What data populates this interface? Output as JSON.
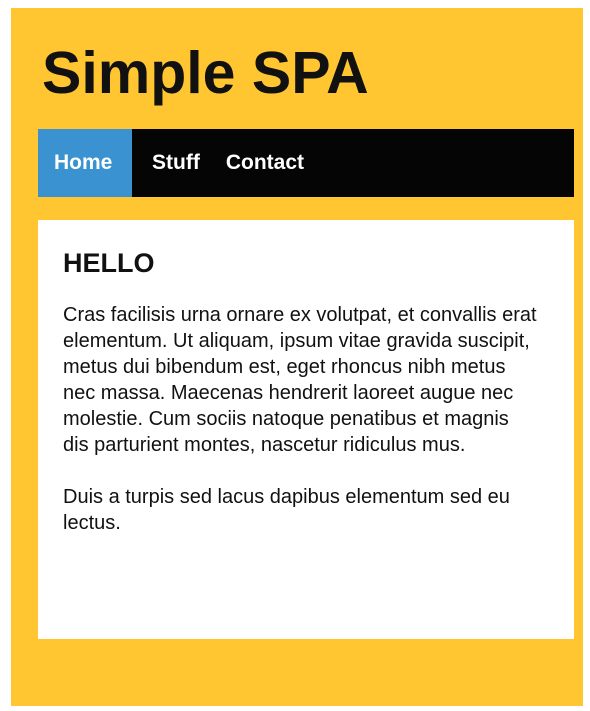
{
  "header": {
    "title": "Simple SPA"
  },
  "nav": {
    "items": [
      {
        "label": "Home",
        "active": true
      },
      {
        "label": "Stuff",
        "active": false
      },
      {
        "label": "Contact",
        "active": false
      }
    ]
  },
  "content": {
    "heading": "HELLO",
    "paragraphs": [
      "Cras facilisis urna ornare ex volutpat, et convallis erat elementum. Ut aliquam, ipsum vitae gravida suscipit, metus dui bibendum est, eget rhoncus nibh metus nec massa. Maecenas hendrerit laoreet augue nec molestie. Cum sociis natoque penatibus et magnis dis parturient montes, nascetur ridiculus mus.",
      "Duis a turpis sed lacus dapibus elementum sed eu lectus."
    ]
  },
  "colors": {
    "page_background": "#ffc632",
    "nav_background": "#050505",
    "nav_active": "#3a92d1",
    "content_background": "#ffffff",
    "text": "#111111"
  }
}
